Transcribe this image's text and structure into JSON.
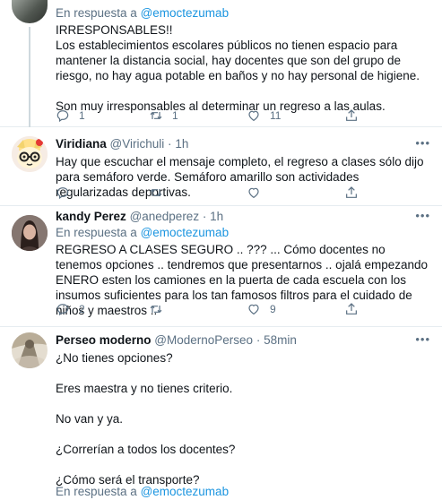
{
  "tweets": [
    {
      "reply_prefix": "En respuesta a",
      "reply_to": "@emoctezumab",
      "paragraphs": [
        "IRRESPONSABLES!!",
        "Los establecimientos escolares públicos no tienen espacio para mantener la distancia social, hay docentes que son del grupo de riesgo, no hay agua potable en baños y no hay personal de higiene.",
        "",
        "Son muy irresponsables al determinar un regreso a las aulas."
      ],
      "replies": "1",
      "retweets": "1",
      "likes": "11"
    },
    {
      "name": "Viridiana",
      "handle": "@Virichuli",
      "dot": "·",
      "time": "1h",
      "more": "•••",
      "paragraphs": [
        "Hay que escuchar el mensaje completo, el regreso a clases sólo dijo para semáforo verde. Semáforo amarillo son actividades regularizadas deportivas."
      ],
      "replies": "",
      "retweets": "",
      "likes": ""
    },
    {
      "name": "kandy Perez",
      "handle": "@anedperez",
      "dot": "·",
      "time": "1h",
      "more": "•••",
      "reply_prefix": "En respuesta a",
      "reply_to": "@emoctezumab",
      "paragraphs": [
        "REGRESO A CLASES SEGURO .. ??? ... Cómo docentes no tenemos opciones .. tendremos que presentarnos .. ojalá empezando ENERO esten los camiones en la puerta de cada escuela con los insumos suficientes para los tan famosos filtros para el cuidado de niños y maestros .."
      ],
      "replies": "2",
      "retweets": "",
      "likes": "9"
    },
    {
      "name": "Perseo moderno",
      "handle": "@ModernoPerseo",
      "dot": "·",
      "time": "58min",
      "more": "•••",
      "reply_prefix": "En respuesta a",
      "reply_to": "@emoctezumab",
      "paragraphs": [
        "¿No tienes opciones?",
        "",
        "Eres maestra y no tienes criterio.",
        "",
        "No van y ya.",
        "",
        "¿Correrían a todos los docentes?",
        "",
        "¿Cómo será el transporte?"
      ]
    }
  ],
  "icons": {
    "reply": "reply-icon",
    "retweet": "retweet-icon",
    "like": "heart-icon",
    "share": "share-icon"
  },
  "colors": {
    "link": "#1b95e0",
    "secondary_text": "#5b7083",
    "divider": "#e6ecf0"
  }
}
